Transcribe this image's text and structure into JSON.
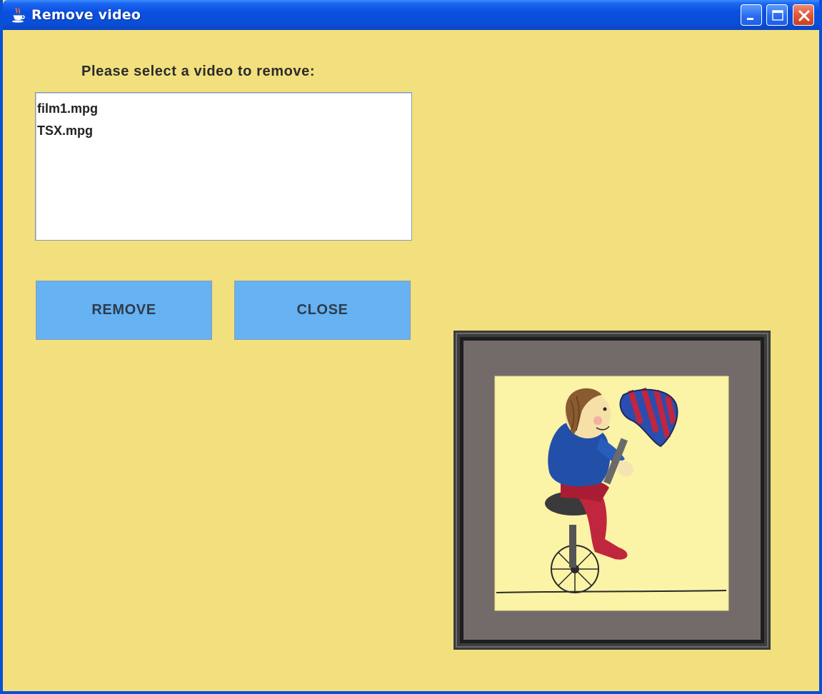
{
  "window": {
    "title": "Remove video",
    "icon": "java-cup-icon",
    "controls": [
      "minimize-icon",
      "maximize-icon",
      "close-icon"
    ]
  },
  "main": {
    "prompt": "Please select a video to remove:",
    "videos": [
      "film1.mpg",
      "TSX.mpg"
    ],
    "buttons": {
      "remove_label": "REMOVE",
      "close_label": "CLOSE"
    },
    "picture": "child-on-unicycle-illustration"
  },
  "colors": {
    "background": "#f2e07e",
    "button": "#66b2f2",
    "titlebar": "#0a4fd8"
  }
}
